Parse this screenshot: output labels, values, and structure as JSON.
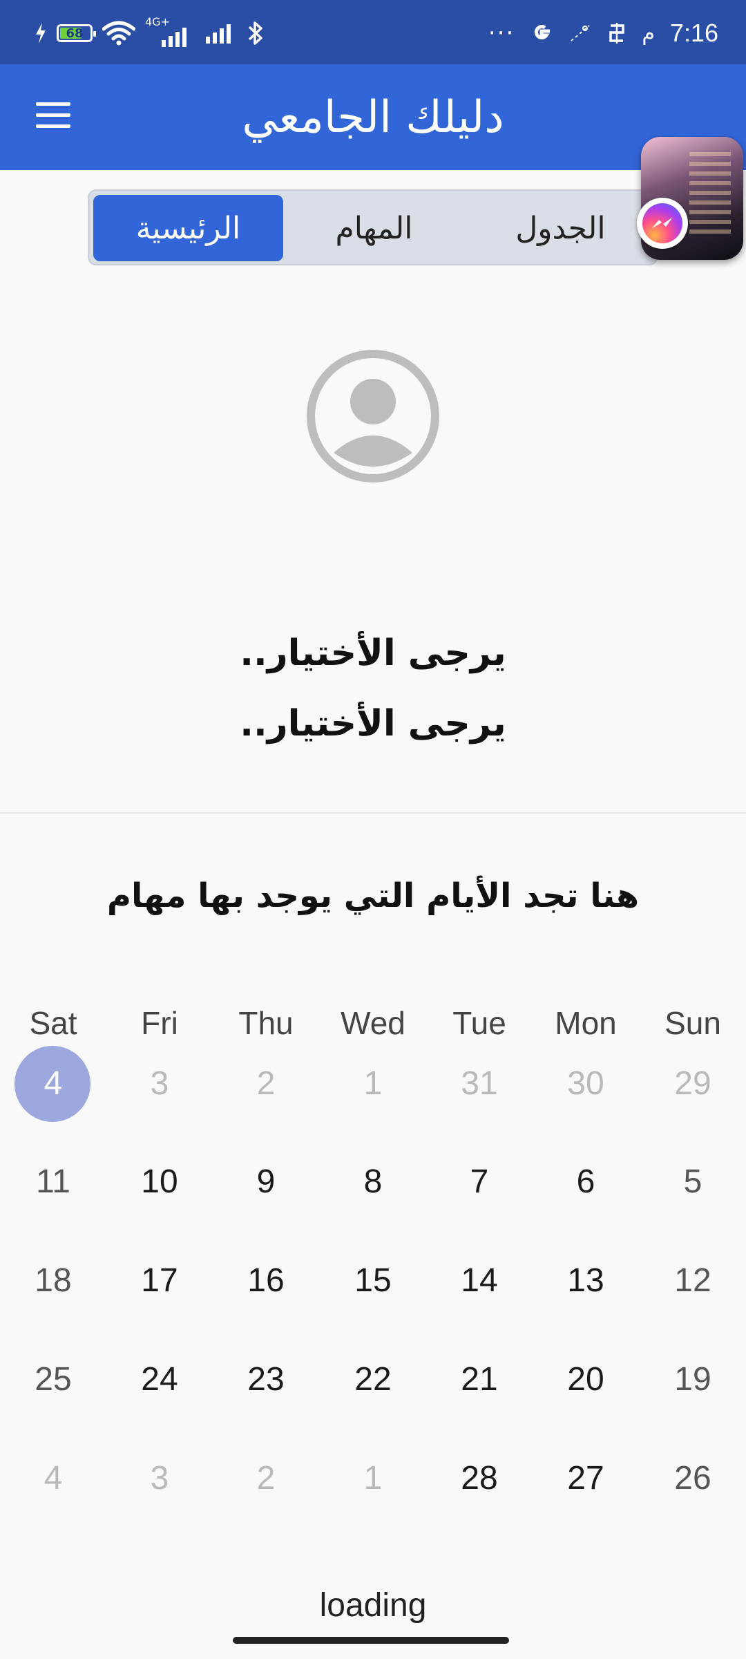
{
  "status_bar": {
    "battery_level": "68",
    "network_label": "4G+",
    "time": "7:16",
    "ampm": "م",
    "more": "···"
  },
  "app_bar": {
    "title": "دليلك الجامعي",
    "icon": "menu-icon"
  },
  "tabs": [
    {
      "label": "الرئيسية",
      "active": true
    },
    {
      "label": "المهام",
      "active": false
    },
    {
      "label": "الجدول",
      "active": false
    }
  ],
  "profile": {
    "icon": "avatar-placeholder-icon",
    "line1": "..يرجى الأختيار",
    "line2": "..يرجى الأختيار"
  },
  "calendar": {
    "heading": "هنا تجد الأيام التي يوجد بها مهام",
    "weekdays": [
      "Sat",
      "Fri",
      "Thu",
      "Wed",
      "Tue",
      "Mon",
      "Sun"
    ],
    "selected_day": "4",
    "weeks": [
      [
        "4",
        "3",
        "2",
        "1",
        "31",
        "30",
        "29"
      ],
      [
        "11",
        "10",
        "9",
        "8",
        "7",
        "6",
        "5"
      ],
      [
        "18",
        "17",
        "16",
        "15",
        "14",
        "13",
        "12"
      ],
      [
        "25",
        "24",
        "23",
        "22",
        "21",
        "20",
        "19"
      ],
      [
        "4",
        "3",
        "2",
        "1",
        "28",
        "27",
        "26"
      ]
    ]
  },
  "footer": {
    "loading_text": "loading"
  }
}
